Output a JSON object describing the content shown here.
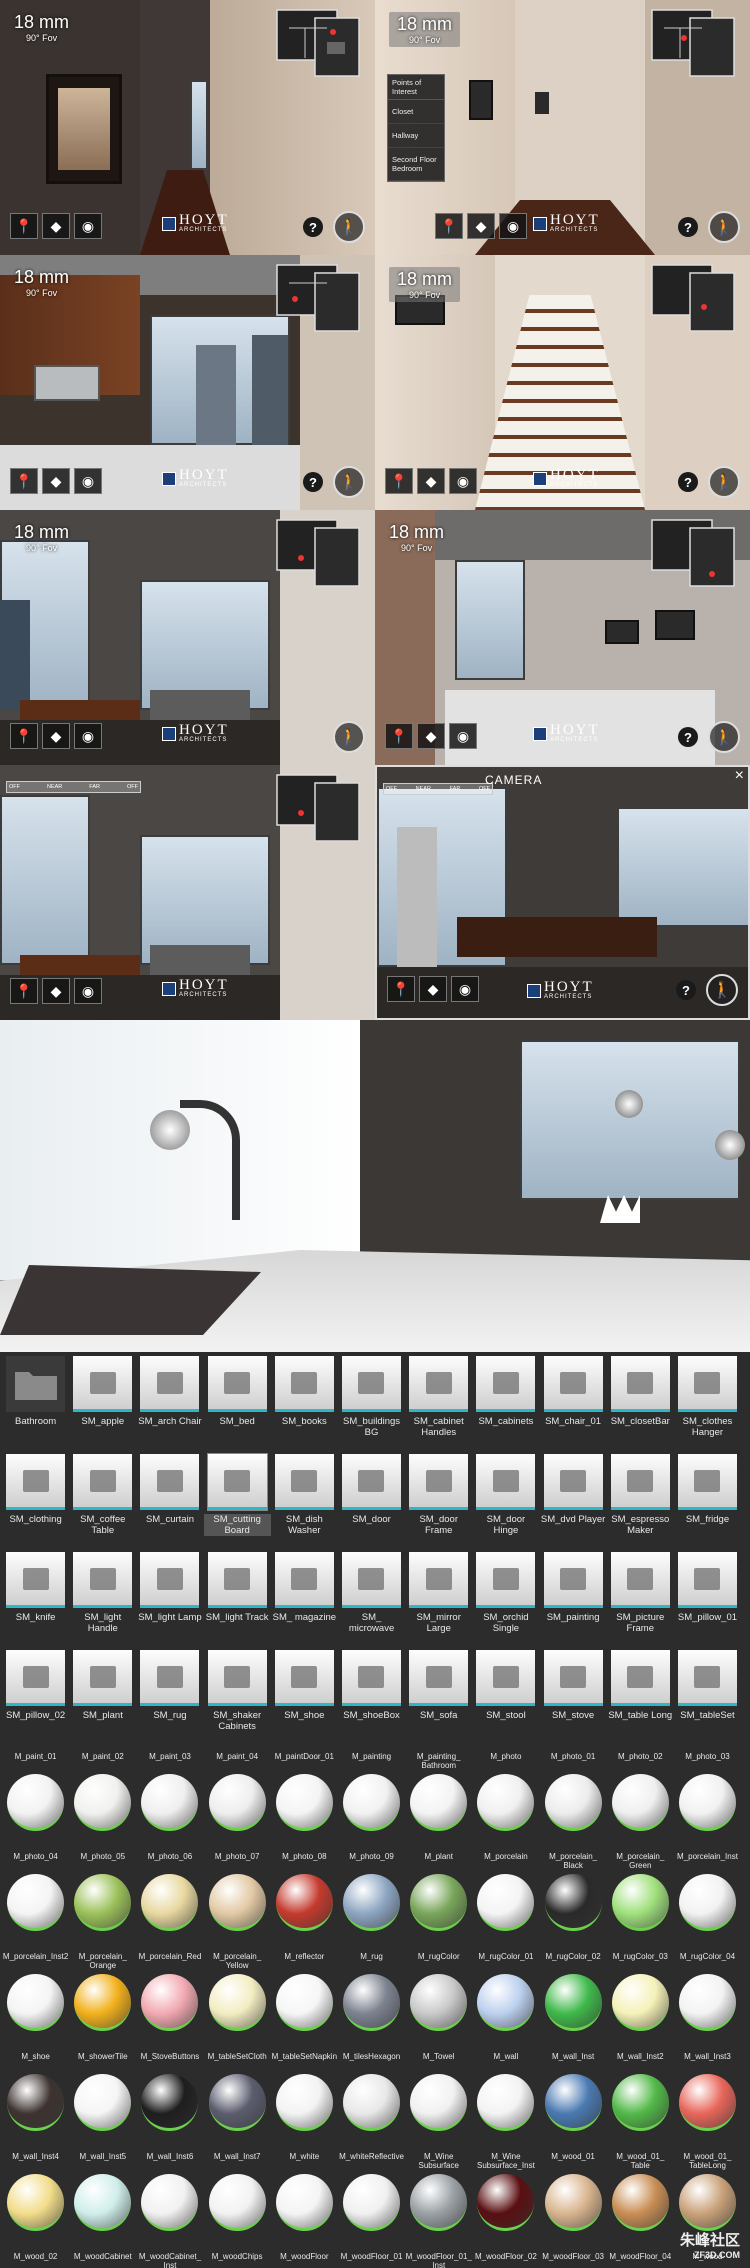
{
  "lens": {
    "mm": "18 mm",
    "fov": "90° Fov"
  },
  "logo": {
    "name": "HOYT",
    "sub": "ARCHITECTS"
  },
  "help_label": "?",
  "poi_menu": {
    "header": "Points of Interest",
    "items": [
      "Closet",
      "Hallway",
      "Second Floor Bedroom"
    ]
  },
  "dof": {
    "off_left": "OFF",
    "near": "NEAR",
    "far": "FAR",
    "off_right": "OFF"
  },
  "camera_label": "CAMERA",
  "close_label": "×",
  "assets": [
    {
      "label": "Bathroom",
      "folder": true
    },
    {
      "label": "SM_apple"
    },
    {
      "label": "SM_arch Chair"
    },
    {
      "label": "SM_bed"
    },
    {
      "label": "SM_books"
    },
    {
      "label": "SM_buildings BG"
    },
    {
      "label": "SM_cabinet Handles"
    },
    {
      "label": "SM_cabinets"
    },
    {
      "label": "SM_chair_01"
    },
    {
      "label": "SM_closetBar"
    },
    {
      "label": "SM_clothes Hanger"
    },
    {
      "label": "SM_clothing"
    },
    {
      "label": "SM_coffee Table"
    },
    {
      "label": "SM_curtain"
    },
    {
      "label": "SM_cutting Board",
      "selected": true
    },
    {
      "label": "SM_dish Washer"
    },
    {
      "label": "SM_door"
    },
    {
      "label": "SM_door Frame"
    },
    {
      "label": "SM_door Hinge"
    },
    {
      "label": "SM_dvd Player"
    },
    {
      "label": "SM_espresso Maker"
    },
    {
      "label": "SM_fridge"
    },
    {
      "label": "SM_knife"
    },
    {
      "label": "SM_light Handle"
    },
    {
      "label": "SM_light Lamp"
    },
    {
      "label": "SM_light Track"
    },
    {
      "label": "SM_ magazine"
    },
    {
      "label": "SM_ microwave"
    },
    {
      "label": "SM_mirror Large"
    },
    {
      "label": "SM_orchid Single"
    },
    {
      "label": "SM_painting"
    },
    {
      "label": "SM_picture Frame"
    },
    {
      "label": "SM_pillow_01"
    },
    {
      "label": "SM_pillow_02"
    },
    {
      "label": "SM_plant"
    },
    {
      "label": "SM_rug"
    },
    {
      "label": "SM_shaker Cabinets"
    },
    {
      "label": "SM_shoe"
    },
    {
      "label": "SM_shoeBox"
    },
    {
      "label": "SM_sofa"
    },
    {
      "label": "SM_stool"
    },
    {
      "label": "SM_stove"
    },
    {
      "label": "SM_table Long"
    },
    {
      "label": "SM_tableSet"
    }
  ],
  "materials": [
    {
      "label": "M_paint_01",
      "color": "#f2f2f2"
    },
    {
      "label": "M_paint_02",
      "color": "#f0f0ee"
    },
    {
      "label": "M_paint_03",
      "color": "#efefef"
    },
    {
      "label": "M_paint_04",
      "color": "#eeeeee"
    },
    {
      "label": "M_paintDoor_01",
      "color": "#f4f4f4"
    },
    {
      "label": "M_painting",
      "color": "#f1f1f1"
    },
    {
      "label": "M_painting_ Bathroom",
      "color": "#f3f3f3"
    },
    {
      "label": "M_photo",
      "color": "#f0f0f0"
    },
    {
      "label": "M_photo_01",
      "color": "#ececec"
    },
    {
      "label": "M_photo_02",
      "color": "#efefef"
    },
    {
      "label": "M_photo_03",
      "color": "#f1f1f1"
    },
    {
      "label": "M_photo_04",
      "color": "#f4f4f4"
    },
    {
      "label": "M_photo_05",
      "color": "#9cc15a"
    },
    {
      "label": "M_photo_06",
      "color": "#e8d8a0"
    },
    {
      "label": "M_photo_07",
      "color": "#e2c9a4"
    },
    {
      "label": "M_photo_08",
      "color": "#c43a2e"
    },
    {
      "label": "M_photo_09",
      "color": "#8ea6c2"
    },
    {
      "label": "M_plant",
      "color": "#79a65a"
    },
    {
      "label": "M_porcelain",
      "color": "#f4f4f4"
    },
    {
      "label": "M_porcelain_ Black",
      "color": "#2a2a2a"
    },
    {
      "label": "M_porcelain_ Green",
      "color": "#9fe07c"
    },
    {
      "label": "M_porcelain_Inst",
      "color": "#f2f2f2"
    },
    {
      "label": "M_porcelain_Inst2",
      "color": "#f4f4f4"
    },
    {
      "label": "M_porcelain_ Orange",
      "color": "#f2b11c"
    },
    {
      "label": "M_porcelain_Red",
      "color": "#f2a9b2"
    },
    {
      "label": "M_porcelain_ Yellow",
      "color": "#f3edc2"
    },
    {
      "label": "M_reflector",
      "color": "#f6f6f6"
    },
    {
      "label": "M_rug",
      "color": "#7d8390"
    },
    {
      "label": "M_rugColor",
      "color": "#c9c9c9"
    },
    {
      "label": "M_rugColor_01",
      "color": "#bcd0ee"
    },
    {
      "label": "M_rugColor_02",
      "color": "#3fb94a"
    },
    {
      "label": "M_rugColor_03",
      "color": "#f5f1b8"
    },
    {
      "label": "M_rugColor_04",
      "color": "#f3f3f3"
    },
    {
      "label": "M_shoe",
      "color": "#3d3330"
    },
    {
      "label": "M_showerTile",
      "color": "#f5f5f5"
    },
    {
      "label": "M_StoveButtons",
      "color": "#1e1e1e"
    },
    {
      "label": "M_tableSetCloth",
      "color": "#5b5d6e"
    },
    {
      "label": "M_tableSetNapkin",
      "color": "#f3f3f3"
    },
    {
      "label": "M_tilesHexagon",
      "color": "#e8e8e8"
    },
    {
      "label": "M_Towel",
      "color": "#f1f1f1"
    },
    {
      "label": "M_wall",
      "color": "#f3f3f3"
    },
    {
      "label": "M_wall_Inst",
      "color": "#4a7ab2"
    },
    {
      "label": "M_wall_Inst2",
      "color": "#52b948"
    },
    {
      "label": "M_wall_Inst3",
      "color": "#e8665a"
    },
    {
      "label": "M_wall_Inst4",
      "color": "#f2dd8a"
    },
    {
      "label": "M_wall_Inst5",
      "color": "#cfeeea"
    },
    {
      "label": "M_wall_Inst6",
      "color": "#f1f1f1"
    },
    {
      "label": "M_wall_Inst7",
      "color": "#f2f2f2"
    },
    {
      "label": "M_white",
      "color": "#f4f4f4"
    },
    {
      "label": "M_whiteReflective",
      "color": "#f0f0f0"
    },
    {
      "label": "M_Wine Subsurface",
      "color": "#9aa0a4"
    },
    {
      "label": "M_Wine Subsurface_Inst",
      "color": "#5a0f12"
    },
    {
      "label": "M_wood_01",
      "color": "#d9b58f"
    },
    {
      "label": "M_wood_01_ Table",
      "color": "#c98e55"
    },
    {
      "label": "M_wood_01_ TableLong",
      "color": "#c9a27a"
    },
    {
      "label": "M_wood_02",
      "color": "#9a4f2c"
    },
    {
      "label": "M_woodCabinet",
      "color": "#b98a5c"
    },
    {
      "label": "M_woodCabinet_ Inst",
      "color": "#6a3b24"
    },
    {
      "label": "M_woodChips",
      "color": "#b59a76"
    },
    {
      "label": "M_woodFloor",
      "color": "#a9663b"
    },
    {
      "label": "M_woodFloor_01",
      "color": "#6d2e1c"
    },
    {
      "label": "M_woodFloor_01_ Inst",
      "color": "#7a3a28"
    },
    {
      "label": "M_woodFloor_02",
      "color": "#e7d8c8"
    },
    {
      "label": "M_woodFloor_03",
      "color": "#efe4d6"
    },
    {
      "label": "M_woodFloor_04",
      "color": "#2b2522"
    },
    {
      "label": "M_wood",
      "color": "#e5d7c9"
    }
  ],
  "watermark": {
    "main": "朱峰社区",
    "sub": "ZF3D.COM"
  }
}
